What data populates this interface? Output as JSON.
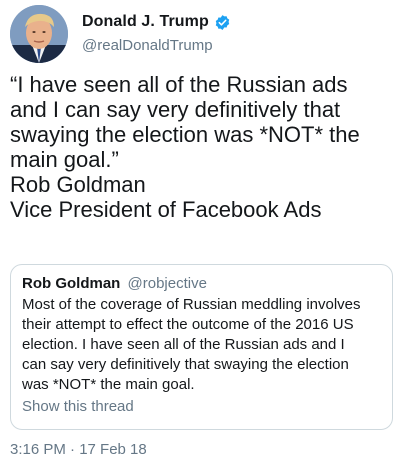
{
  "author": {
    "display_name": "Donald J. Trump",
    "handle": "@realDonaldTrump",
    "verified": true,
    "avatar_icon": "profile-photo"
  },
  "tweet": {
    "lines": [
      "“I have seen all of the Russian ads",
      "and I can say very definitively that",
      "swaying the election was *NOT* the",
      "main goal.”",
      "Rob Goldman",
      "Vice President of Facebook Ads"
    ],
    "timestamp": "3:16 PM · 17 Feb 18"
  },
  "quoted_tweet": {
    "display_name": "Rob Goldman",
    "handle": "@robjective",
    "lines": [
      "Most of the coverage of Russian meddling involves",
      "their attempt to effect the outcome of the 2016 US",
      "election.  I have seen all of the Russian ads and I",
      "can say very definitively that swaying the election",
      "was *NOT* the main goal."
    ],
    "show_thread": "Show this thread"
  },
  "colors": {
    "text": "#14171a",
    "secondary": "#657786",
    "verified": "#1da1f2",
    "border": "#cfd9de"
  }
}
